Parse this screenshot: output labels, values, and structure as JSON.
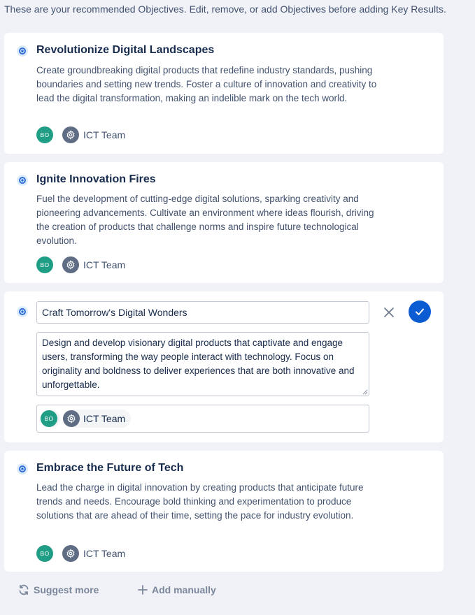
{
  "intro_text": "These are your recommended Objectives. Edit, remove, or add Objectives before adding Key Results.",
  "objectives": [
    {
      "title": "Revolutionize Digital Landscapes",
      "description": "Create groundbreaking digital products that redefine industry standards, pushing boundaries and setting new trends. Foster a culture of innovation and creativity to lead the digital transformation, making an indelible mark on the tech world.",
      "owner_initials": "BO",
      "team": "ICT Team"
    },
    {
      "title": "Ignite Innovation Fires",
      "description": "Fuel the development of cutting-edge digital solutions, sparking creativity and pioneering advancements. Cultivate an environment where ideas flourish, driving the creation of products that challenge norms and inspire future technological evolution.",
      "owner_initials": "BO",
      "team": "ICT Team"
    },
    {
      "title": "Embrace the Future of Tech",
      "description": "Lead the charge in digital innovation by creating products that anticipate future trends and needs. Encourage bold thinking and experimentation to produce solutions that are ahead of their time, setting the pace for industry evolution.",
      "owner_initials": "BO",
      "team": "ICT Team"
    }
  ],
  "editing": {
    "title_value": "Craft Tomorrow's Digital Wonders",
    "description_value": "Design and develop visionary digital products that captivate and engage users, transforming the way people interact with technology. Focus on originality and boldness to deliver experiences that are both innovative and unforgettable.",
    "owner_initials": "BO",
    "team": "ICT Team"
  },
  "footer": {
    "suggest_more": "Suggest more",
    "add_manually": "Add manually"
  },
  "colors": {
    "accent": "#0b5bd3",
    "avatar": "#1f9e85",
    "team_icon": "#5e6c84",
    "background": "#f1f2f8"
  },
  "icons": {
    "objective": "objective-target-icon",
    "team": "gear-icon",
    "cancel": "close-icon",
    "confirm": "check-icon",
    "suggest": "refresh-icon",
    "add": "plus-icon"
  }
}
